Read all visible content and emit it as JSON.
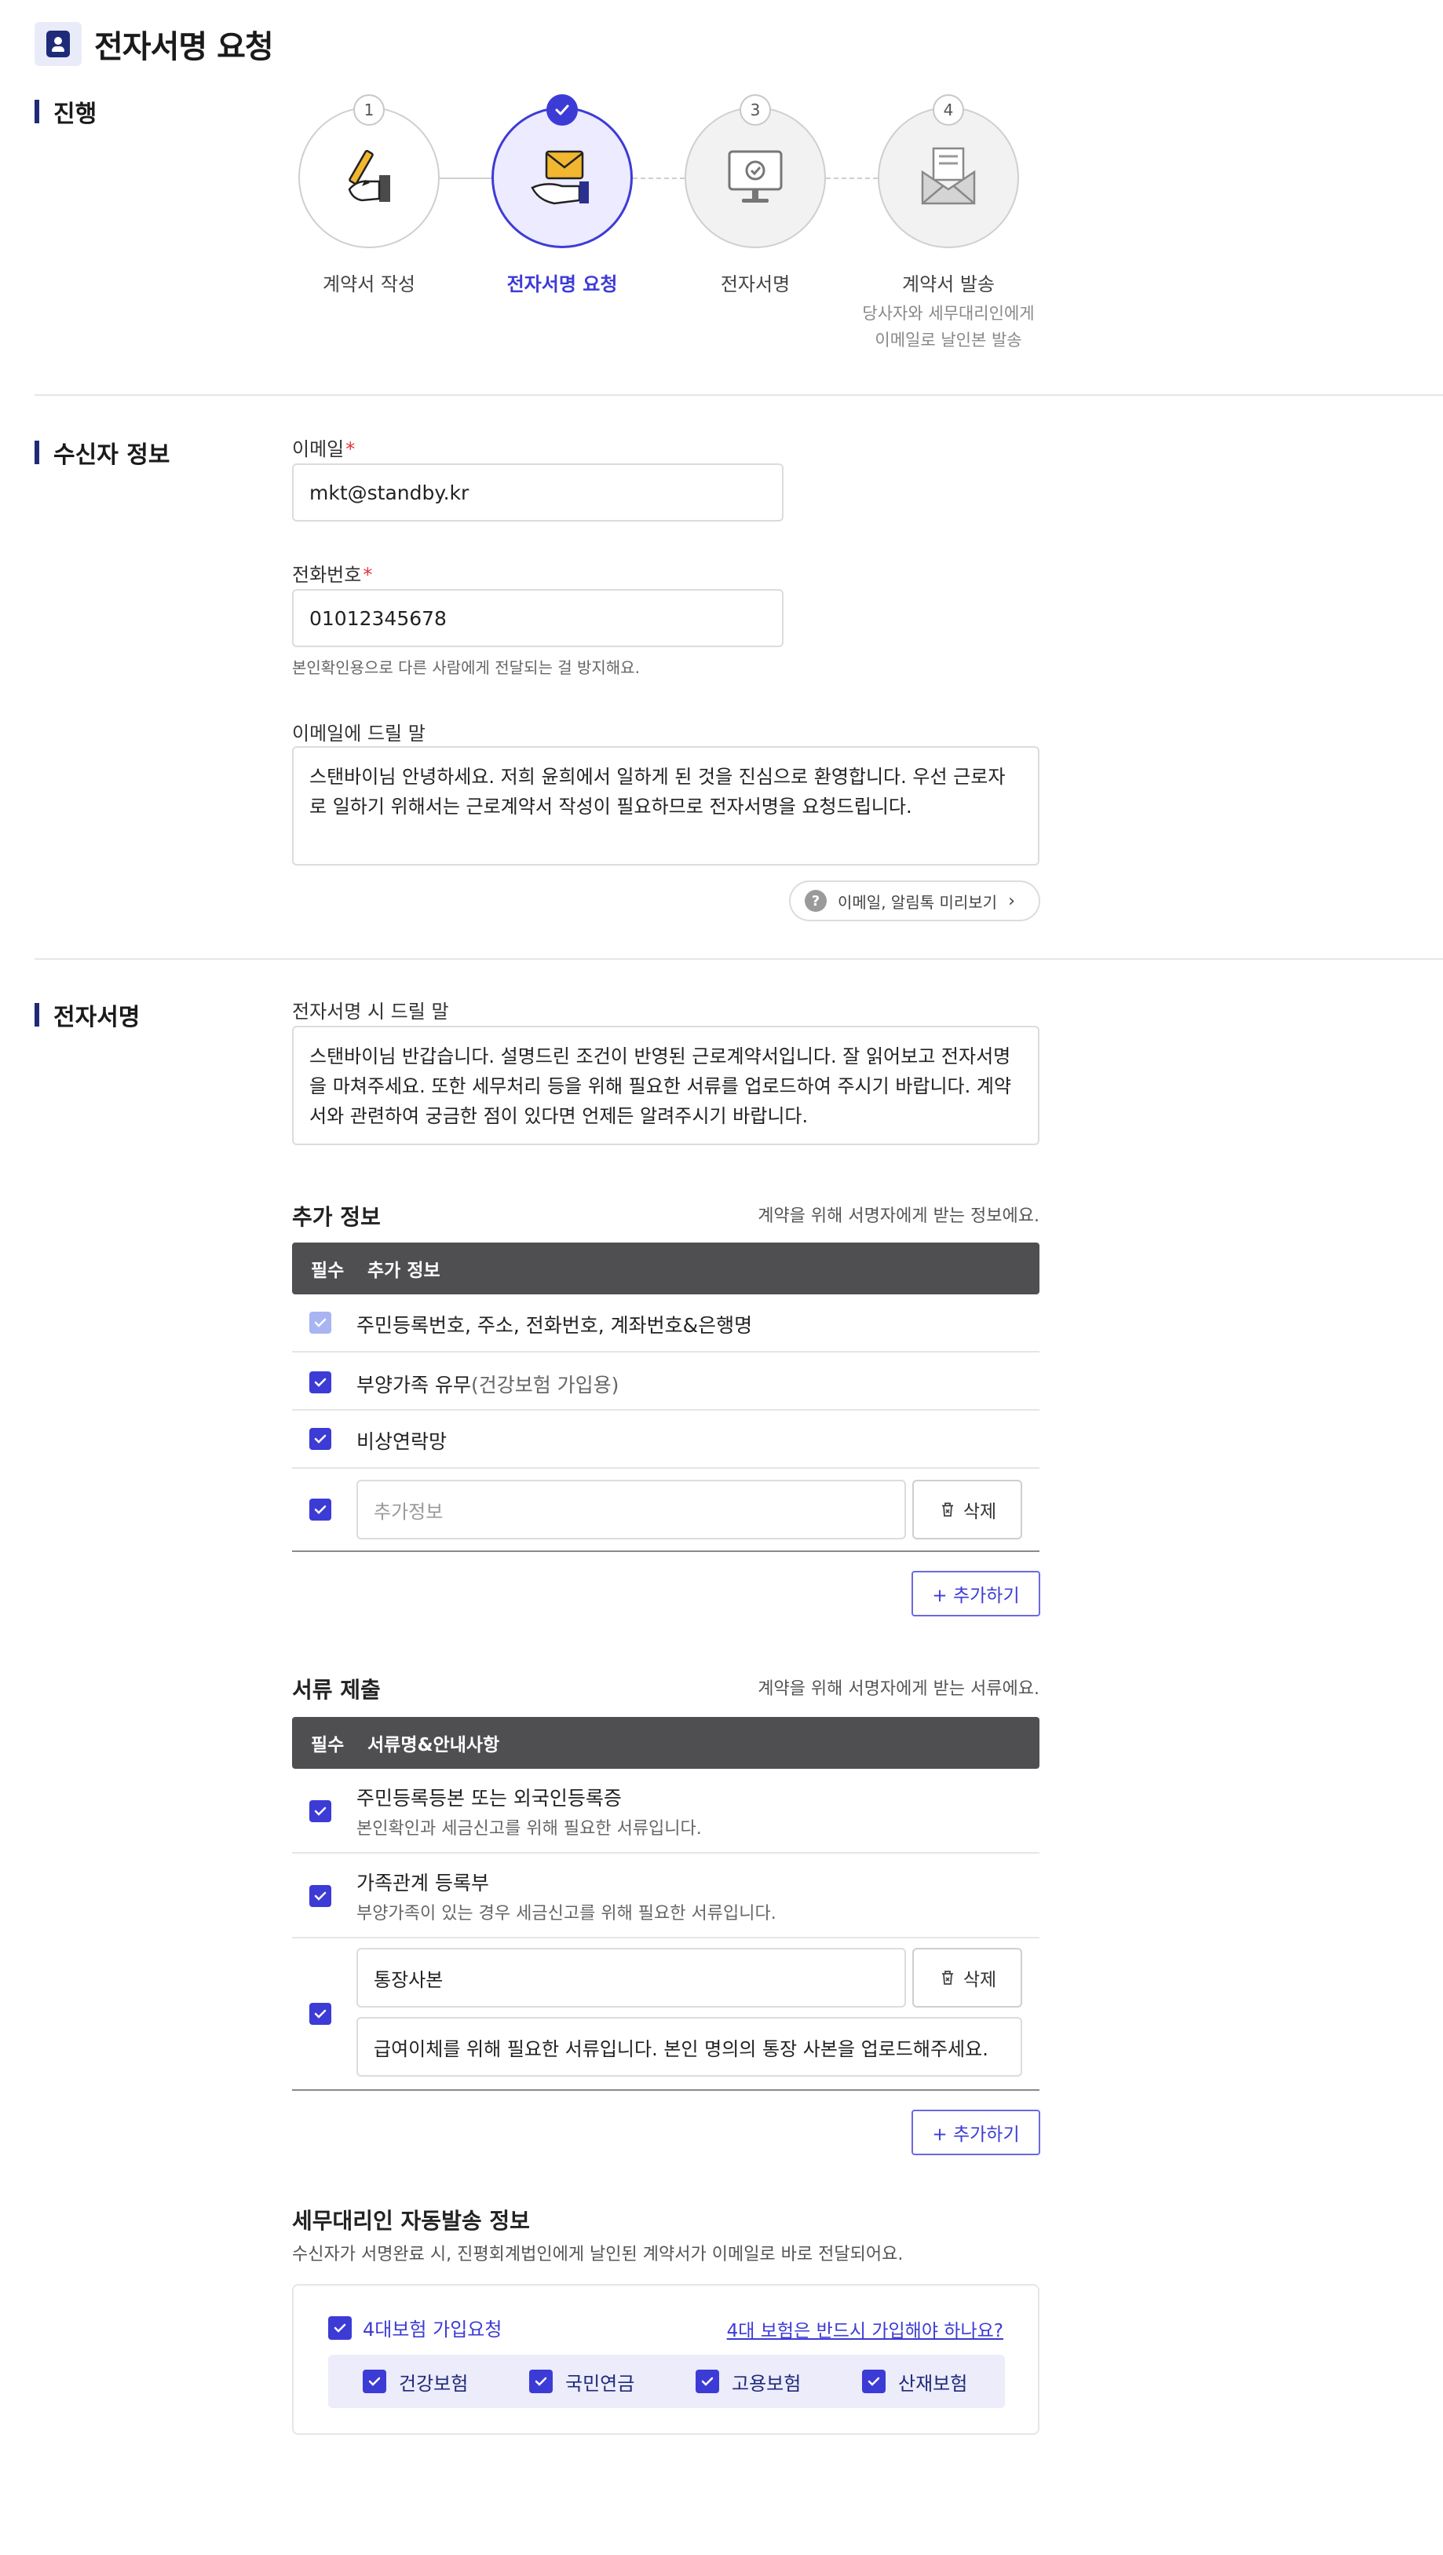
{
  "header": {
    "title": "전자서명 요청",
    "icon": "contract-person-icon"
  },
  "progress": {
    "section_label": "진행",
    "steps": [
      {
        "num": "1",
        "label": "계약서 작성",
        "state": "done",
        "icon": "pen-hand-icon"
      },
      {
        "num": "",
        "label": "전자서명 요청",
        "state": "active",
        "icon": "mail-hand-icon"
      },
      {
        "num": "3",
        "label": "전자서명",
        "state": "pending",
        "icon": "monitor-check-icon"
      },
      {
        "num": "4",
        "label": "계약서 발송",
        "state": "pending",
        "icon": "envelope-doc-icon",
        "sub1": "당사자와 세무대리인에게",
        "sub2": "이메일로 날인본 발송"
      }
    ]
  },
  "recipient": {
    "section_label": "수신자 정보",
    "email_label": "이메일",
    "email_value": "mkt@standby.kr",
    "phone_label": "전화번호",
    "phone_value": "01012345678",
    "phone_helper": "본인확인용으로 다른 사람에게 전달되는 걸 방지해요.",
    "message_label": "이메일에 드릴 말",
    "message_value": "스탠바이님 안녕하세요. 저희 윤희에서 일하게 된 것을 진심으로 환영합니다. 우선 근로자로 일하기 위해서는 근로계약서 작성이 필요하므로 전자서명을 요청드립니다.",
    "preview_button": "이메일, 알림톡 미리보기",
    "required_mark": "*"
  },
  "esign": {
    "section_label": "전자서명",
    "sign_message_label": "전자서명 시 드릴 말",
    "sign_message_value": "스탠바이님 반갑습니다. 설명드린 조건이 반영된 근로계약서입니다. 잘 읽어보고 전자서명을 마쳐주세요. 또한 세무처리 등을 위해 필요한 서류를 업로드하여 주시기 바랍니다. 계약서와 관련하여 궁금한 점이 있다면 언제든 알려주시기 바랍니다.",
    "extra_info": {
      "title": "추가 정보",
      "note": "계약을 위해 서명자에게 받는 정보에요.",
      "col_required": "필수",
      "col_name": "추가 정보",
      "rows": [
        {
          "text": "주민등록번호, 주소, 전화번호, 계좌번호&은행명",
          "checked": true,
          "disabled": true
        },
        {
          "text": "부양가족 유무",
          "muted": "(건강보험 가입용)",
          "checked": true
        },
        {
          "text": "비상연락망",
          "checked": true
        }
      ],
      "input_placeholder": "추가정보",
      "delete_label": "삭제",
      "add_label": "+ 추가하기"
    },
    "documents": {
      "title": "서류 제출",
      "note": "계약을 위해 서명자에게 받는 서류에요.",
      "col_required": "필수",
      "col_name": "서류명&안내사항",
      "rows": [
        {
          "title": "주민등록등본 또는 외국인등록증",
          "desc": "본인확인과 세금신고를 위해 필요한 서류입니다.",
          "checked": true
        },
        {
          "title": "가족관계 등록부",
          "desc": "부양가족이 있는 경우 세금신고를 위해 필요한 서류입니다.",
          "checked": true
        }
      ],
      "custom_name": "통장사본",
      "custom_desc": "급여이체를 위해 필요한 서류입니다. 본인 명의의 통장 사본을 업로드해주세요.",
      "delete_label": "삭제",
      "add_label": "+ 추가하기"
    },
    "tax": {
      "title": "세무대리인 자동발송 정보",
      "desc": "수신자가 서명완료 시, 진평회계법인에게 날인된 계약서가 이메일로 바로 전달되어요.",
      "insurance_main": "4대보험 가입요청",
      "insurance_link": "4대 보험은 반드시 가입해야 하나요?",
      "insurance_items": [
        "건강보험",
        "국민연금",
        "고용보험",
        "산재보험"
      ]
    }
  },
  "colors": {
    "accent": "#3d3bd6",
    "navy": "#1f2a78",
    "table_header": "#4f4f51",
    "required": "#e0353b"
  }
}
